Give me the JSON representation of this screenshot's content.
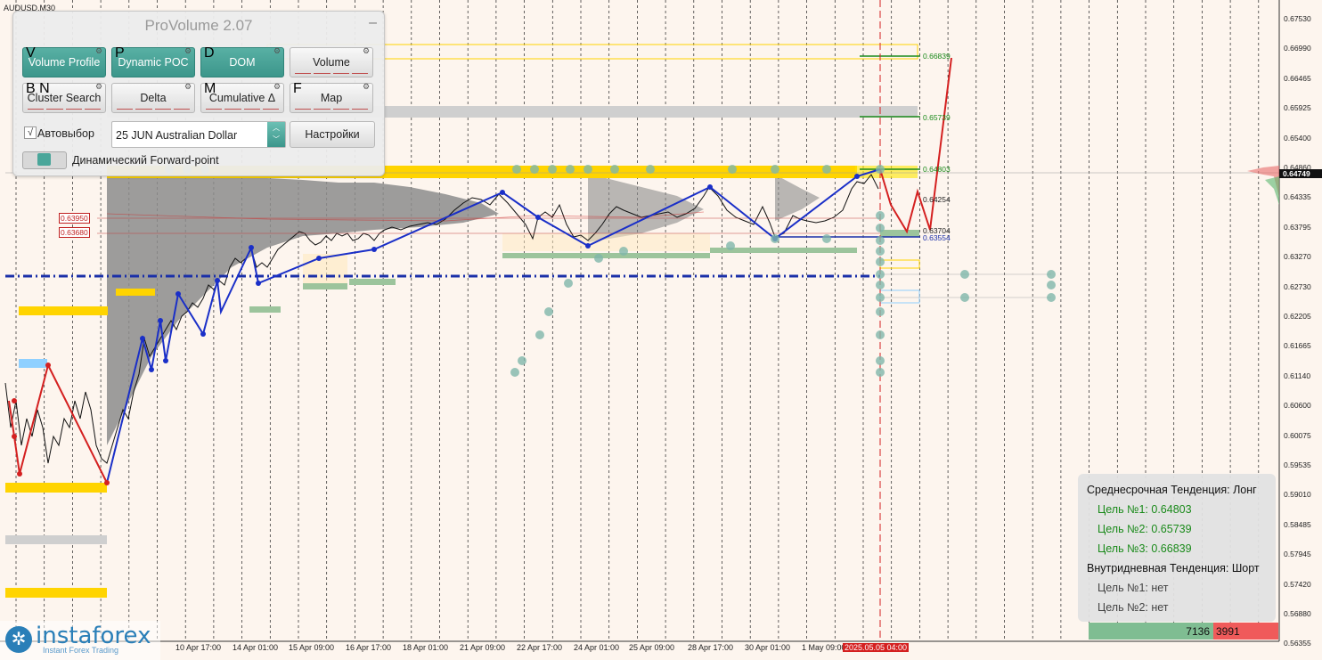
{
  "symbol": "AUDUSD,M30",
  "panel": {
    "title": "ProVolume 2.07",
    "buttons": [
      {
        "label": "Volume Profile",
        "key": "V",
        "active": true
      },
      {
        "label": "Dynamic POC",
        "key": "P",
        "active": true
      },
      {
        "label": "DOM",
        "key": "D",
        "active": true
      },
      {
        "label": "Volume",
        "key": "",
        "active": false
      },
      {
        "label": "Cluster Search",
        "key": "B N",
        "active": false
      },
      {
        "label": "Delta",
        "key": "",
        "active": false
      },
      {
        "label": "Cumulative Δ",
        "key": "M",
        "active": false
      },
      {
        "label": "Map",
        "key": "F",
        "active": false
      }
    ],
    "autoselect_label": "Автовыбор",
    "autoselect_check": "√",
    "instrument": "25 JUN Australian Dollar",
    "settings_label": "Настройки",
    "forward_label": "Динамический Forward-point"
  },
  "price_axis": [
    "0.67530",
    "0.66990",
    "0.66465",
    "0.65925",
    "0.65400",
    "0.64860",
    "0.64335",
    "0.63795",
    "0.63270",
    "0.62730",
    "0.62205",
    "0.61665",
    "0.61140",
    "0.60600",
    "0.60075",
    "0.59535",
    "0.59010",
    "0.58485",
    "0.57945",
    "0.57420",
    "0.56880",
    "0.56355"
  ],
  "current_price": "0.64749",
  "levels": {
    "target1": "0.64803",
    "target2": "0.65739",
    "target3": "0.66839",
    "l4": "0.64254",
    "l5": "0.63704",
    "l6": "0.63554",
    "left1": "0.63950",
    "left2": "0.63680"
  },
  "time_axis": [
    "10 Apr 17:00",
    "14 Apr 01:00",
    "15 Apr 09:00",
    "16 Apr 17:00",
    "18 Apr 01:00",
    "21 Apr 09:00",
    "22 Apr 17:00",
    "24 Apr 01:00",
    "25 Apr 09:00",
    "28 Apr 17:00",
    "30 Apr 01:00",
    "1 May 09:00"
  ],
  "time_current": "2025.05.05 04:00",
  "info": {
    "medium": "Среднесрочная Тенденция: Лонг",
    "t1": "Цель №1: 0.64803",
    "t2": "Цель №2: 0.65739",
    "t3": "Цель №3: 0.66839",
    "intraday": "Внутридневная Тенденция: Шорт",
    "i1": "Цель №1: нет",
    "i2": "Цель №2: нет"
  },
  "volume_bar": {
    "buy": "7136",
    "sell": "3991"
  },
  "logo": {
    "name": "instaforex",
    "sub": "Instant Forex Trading"
  },
  "colors": {
    "up_zigzag": "#1a2fc8",
    "down_zigzag": "#d42020",
    "poc_line": "#1a2fa8",
    "accent": "#3c968b"
  }
}
